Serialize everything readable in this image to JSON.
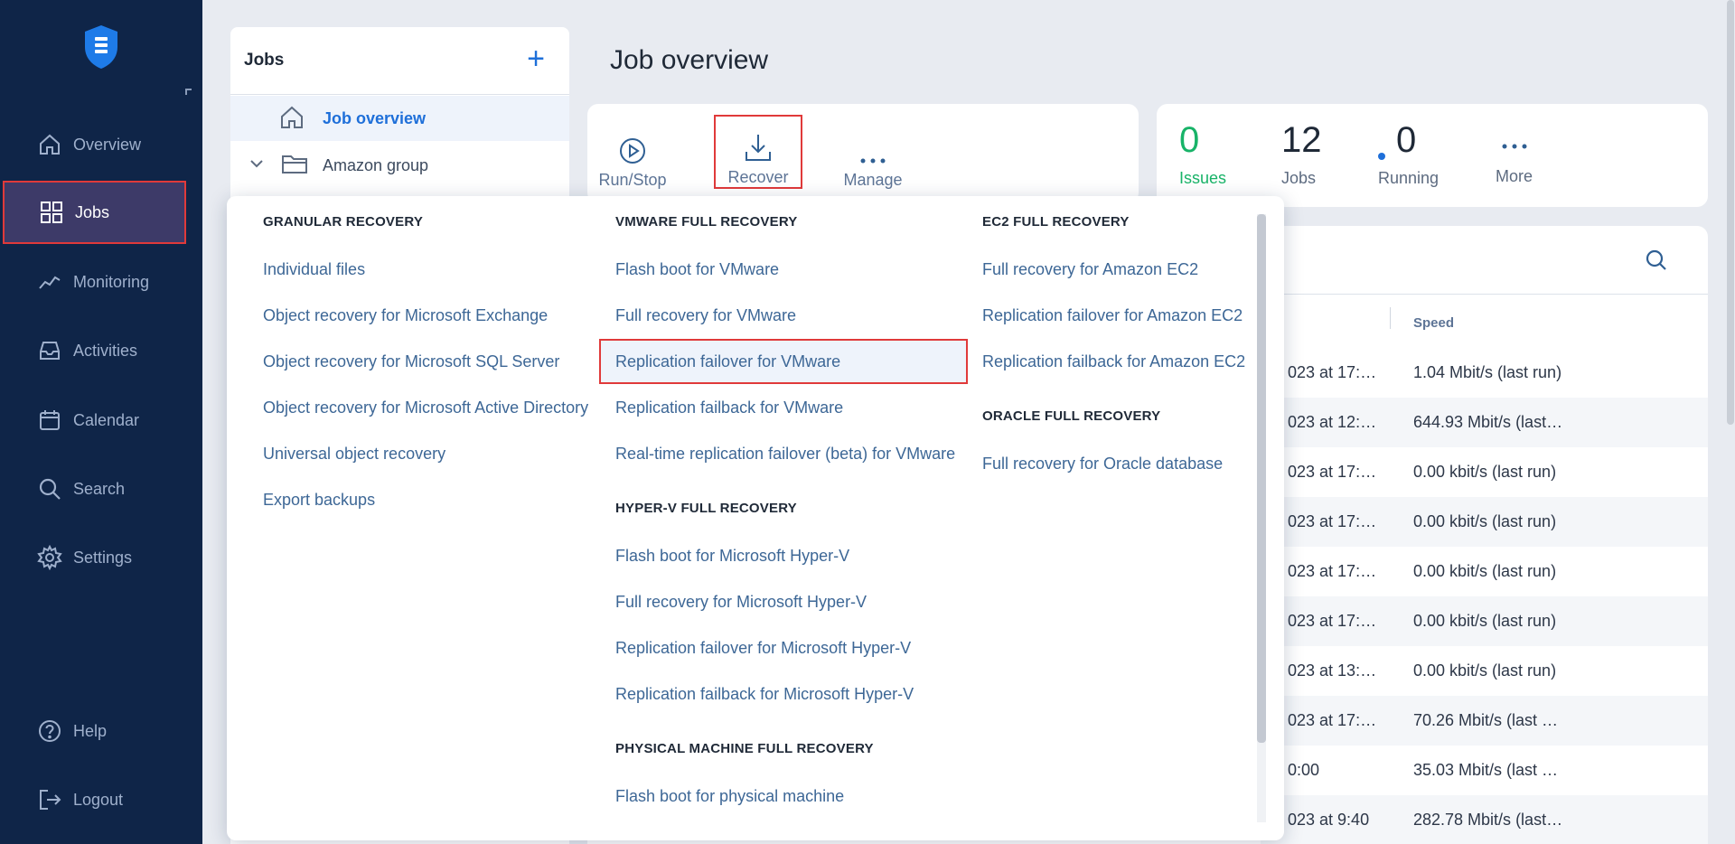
{
  "sidebar": {
    "items": [
      {
        "label": "Overview",
        "icon": "home-icon"
      },
      {
        "label": "Jobs",
        "icon": "grid-icon"
      },
      {
        "label": "Monitoring",
        "icon": "chart-icon"
      },
      {
        "label": "Activities",
        "icon": "inbox-icon"
      },
      {
        "label": "Calendar",
        "icon": "calendar-icon"
      },
      {
        "label": "Search",
        "icon": "search-icon"
      },
      {
        "label": "Settings",
        "icon": "gear-icon"
      }
    ],
    "bottom": [
      {
        "label": "Help",
        "icon": "help-icon"
      },
      {
        "label": "Logout",
        "icon": "logout-icon"
      }
    ],
    "active": "Jobs"
  },
  "jobs_panel": {
    "title": "Jobs",
    "items": [
      {
        "label": "Job overview"
      },
      {
        "label": "Amazon group"
      }
    ]
  },
  "main": {
    "title": "Job overview",
    "toolbar": {
      "run_stop": "Run/Stop",
      "recover": "Recover",
      "manage": "Manage"
    },
    "stats": {
      "issues_value": "0",
      "issues_label": "Issues",
      "jobs_value": "12",
      "jobs_label": "Jobs",
      "running_value": "0",
      "running_label": "Running",
      "more_label": "More"
    },
    "table": {
      "speed_header": "Speed",
      "rows": [
        {
          "date": "023 at 17:…",
          "speed": "1.04 Mbit/s (last run)"
        },
        {
          "date": "023 at 12:…",
          "speed": "644.93 Mbit/s (last…"
        },
        {
          "date": "023 at 17:…",
          "speed": "0.00 kbit/s (last run)"
        },
        {
          "date": "023 at 17:…",
          "speed": "0.00 kbit/s (last run)"
        },
        {
          "date": "023 at 17:…",
          "speed": "0.00 kbit/s (last run)"
        },
        {
          "date": "023 at 17:…",
          "speed": "0.00 kbit/s (last run)"
        },
        {
          "date": "023 at 13:…",
          "speed": "0.00 kbit/s (last run)"
        },
        {
          "date": "023 at 17:…",
          "speed": "70.26 Mbit/s (last …"
        },
        {
          "date": " 0:00",
          "speed": "35.03 Mbit/s (last …"
        },
        {
          "date": "023 at 9:40",
          "speed": "282.78 Mbit/s (last…"
        }
      ]
    }
  },
  "recover_menu": {
    "granular": {
      "heading": "GRANULAR RECOVERY",
      "items": [
        "Individual files",
        "Object recovery for Microsoft Exchange",
        "Object recovery for Microsoft SQL Server",
        "Object recovery for Microsoft Active Directory",
        "Universal object recovery",
        "Export backups"
      ]
    },
    "vmware": {
      "heading": "VMWARE FULL RECOVERY",
      "items": [
        "Flash boot for VMware",
        "Full recovery for VMware",
        "Replication failover for VMware",
        "Replication failback for VMware",
        "Real-time replication failover (beta) for VMware"
      ]
    },
    "hyperv": {
      "heading": "HYPER-V FULL RECOVERY",
      "items": [
        "Flash boot for Microsoft Hyper-V",
        "Full recovery for Microsoft Hyper-V",
        "Replication failover for Microsoft Hyper-V",
        "Replication failback for Microsoft Hyper-V"
      ]
    },
    "physical": {
      "heading": "PHYSICAL MACHINE FULL RECOVERY",
      "items": [
        "Flash boot for physical machine"
      ]
    },
    "ec2": {
      "heading": "EC2 FULL RECOVERY",
      "items": [
        "Full recovery for Amazon EC2",
        "Replication failover for Amazon EC2",
        "Replication failback for Amazon EC2"
      ]
    },
    "oracle": {
      "heading": "ORACLE FULL RECOVERY",
      "items": [
        "Full recovery for Oracle database"
      ]
    },
    "highlighted": "Replication failover for VMware"
  },
  "colors": {
    "sidebar_bg": "#0f2548",
    "accent": "#1e6fd9",
    "link": "#3d6796",
    "issues_green": "#18b368",
    "highlight_border": "#e03a3a"
  }
}
